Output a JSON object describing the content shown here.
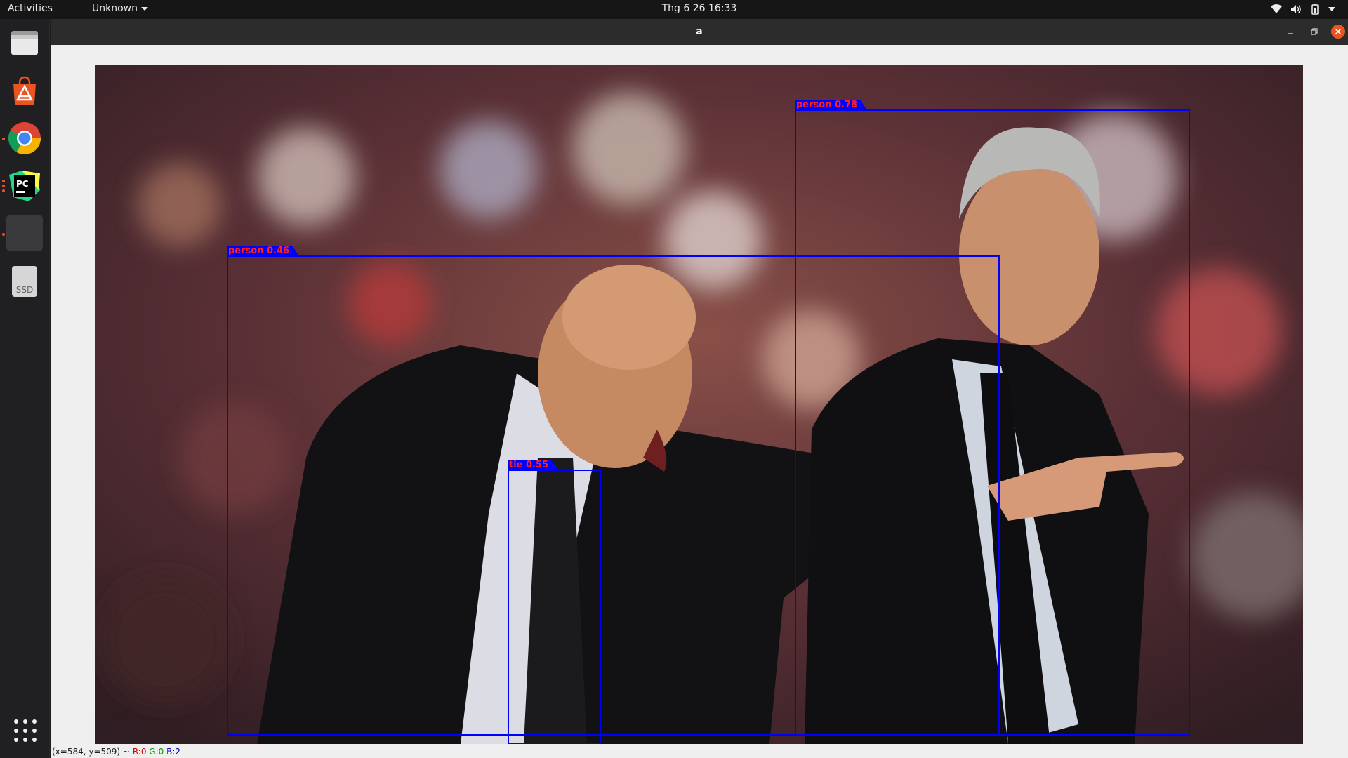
{
  "topbar": {
    "activities": "Activities",
    "app_menu": "Unknown",
    "clock": "Thg 6 26  16:33"
  },
  "dock": {
    "items": [
      {
        "name": "files",
        "icon": "files-icon",
        "running": false
      },
      {
        "name": "software",
        "icon": "ubuntu-software-icon",
        "running": false
      },
      {
        "name": "chrome",
        "icon": "chrome-icon",
        "running": true
      },
      {
        "name": "pycharm",
        "icon": "pycharm-icon",
        "running": true
      },
      {
        "name": "blank-app",
        "icon": "blank-window-icon",
        "running": true
      },
      {
        "name": "ssd",
        "icon": "drive-icon",
        "label": "SSD",
        "running": false
      }
    ]
  },
  "window": {
    "title": "a"
  },
  "detections": [
    {
      "label": "person 0.78"
    },
    {
      "label": "person 0.46"
    },
    {
      "label": "tie 0.55"
    }
  ],
  "status": {
    "coords": "(x=584, y=509) ~",
    "r": "R:0",
    "g": "G:0",
    "b": "B:2"
  },
  "colors": {
    "box": "#0000ff",
    "label_text": "#ff2020",
    "close_button": "#e95420"
  }
}
